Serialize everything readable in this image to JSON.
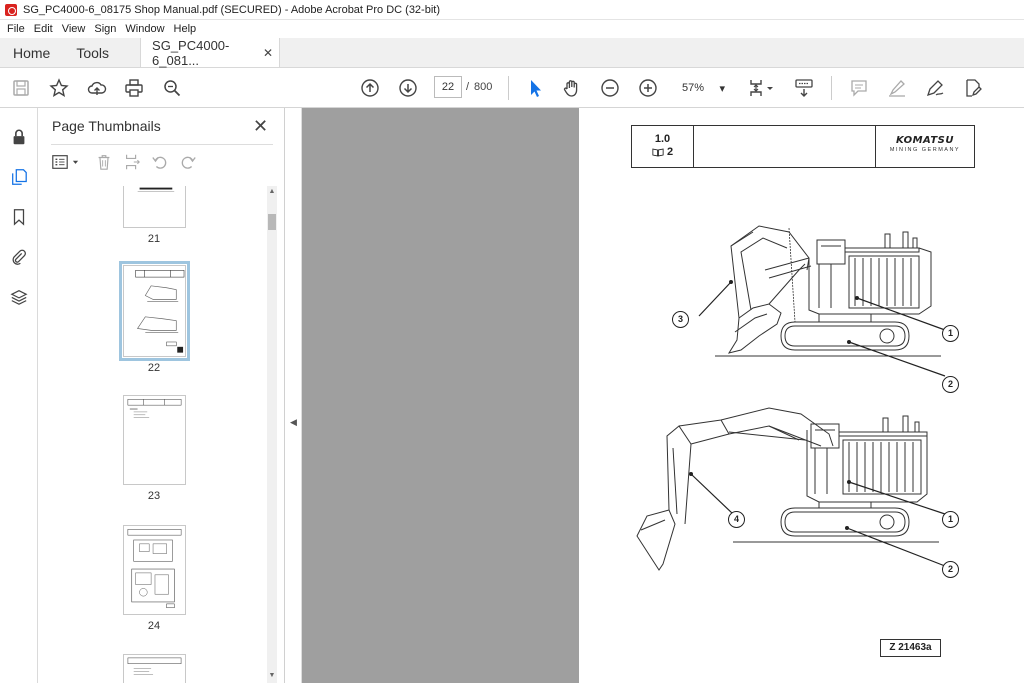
{
  "window": {
    "title": "SG_PC4000-6_08175 Shop Manual.pdf (SECURED) - Adobe Acrobat Pro DC (32-bit)"
  },
  "menu": [
    "File",
    "Edit",
    "View",
    "Sign",
    "Window",
    "Help"
  ],
  "tabs": {
    "home": "Home",
    "tools": "Tools",
    "document": "SG_PC4000-6_081...",
    "close": "✕"
  },
  "toolbar": {
    "current_page": "22",
    "separator": "/",
    "total_pages": "800",
    "zoom": "57%",
    "zoom_caret": "▾"
  },
  "panel": {
    "title": "Page Thumbnails",
    "close": "✕",
    "thumbnails": [
      {
        "page": "21"
      },
      {
        "page": "22",
        "selected": true
      },
      {
        "page": "23"
      },
      {
        "page": "24"
      }
    ]
  },
  "page": {
    "header": {
      "section": "1.0",
      "book_number": "2",
      "brand": "KOMATSU",
      "brand_sub": "MINING GERMANY"
    },
    "callouts": {
      "upper": [
        "3",
        "1",
        "2"
      ],
      "lower": [
        "4",
        "1",
        "2"
      ]
    },
    "figure_ref": "Z 21463a"
  },
  "colors": {
    "doc_background": "#9f9f9f",
    "selected_thumb": "#9ec5df",
    "acrobat_red": "#d9231f"
  }
}
